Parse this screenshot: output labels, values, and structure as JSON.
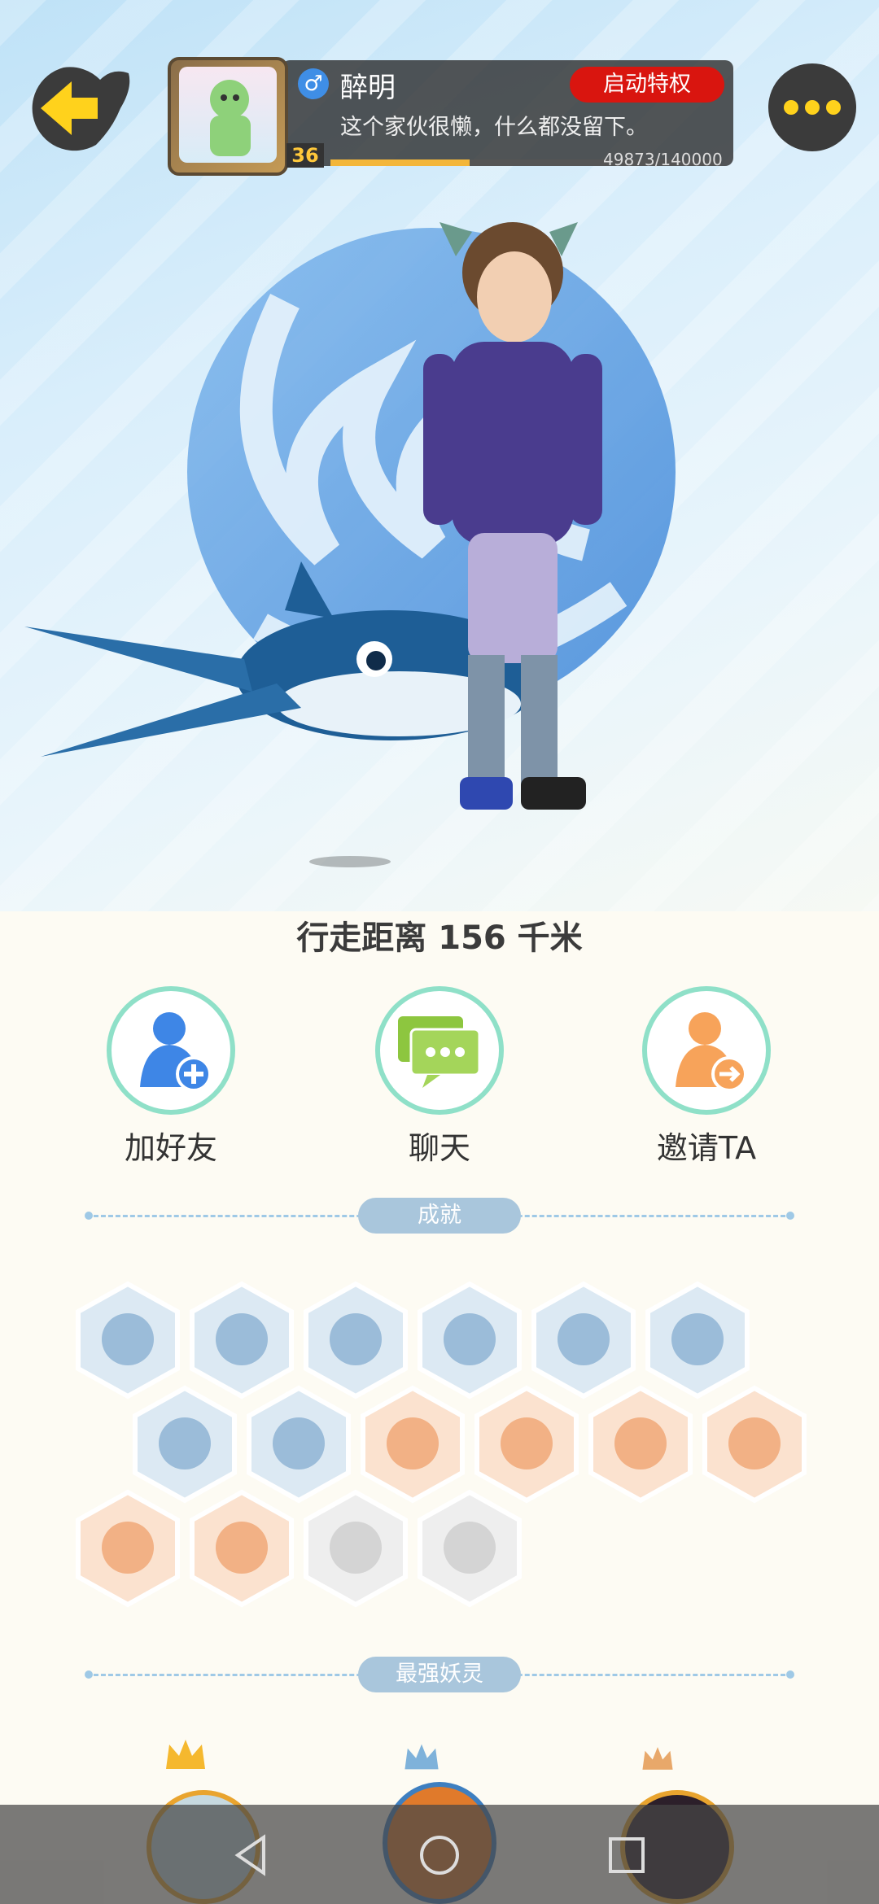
{
  "profile": {
    "name": "醉明",
    "gender_symbol": "♂",
    "privilege_button": "启动特权",
    "signature": "这个家伙很懒，什么都没留下。",
    "level": "36",
    "xp_text": "49873/140000",
    "xp_fraction": 0.356
  },
  "distance_text": "行走距离 156 千米",
  "actions": [
    {
      "label": "加好友",
      "icon": "add-friend-icon"
    },
    {
      "label": "聊天",
      "icon": "chat-icon"
    },
    {
      "label": "邀请TA",
      "icon": "invite-icon"
    }
  ],
  "sections": {
    "achievements": "成就",
    "strongest": "最强妖灵"
  },
  "achievement_icons": [
    "sneaker-badge",
    "orb-badge",
    "cat-badge",
    "moon-badge",
    "crystal-ball-badge",
    "yin-yang-swirl-badge",
    "cat-spirit-badge",
    "taiji-badge",
    "egg-badge",
    "gingerbread-badge",
    "stroller-badge",
    "scroll-badge",
    "ox-badge",
    "fox-badge",
    "dragon-badge",
    "book-badge"
  ],
  "colors": {
    "privilege": "#d9150f",
    "xp_fill": "#f3b63a",
    "back_arrow": "#ffd21c",
    "action_ring": "#8fe0c8"
  }
}
